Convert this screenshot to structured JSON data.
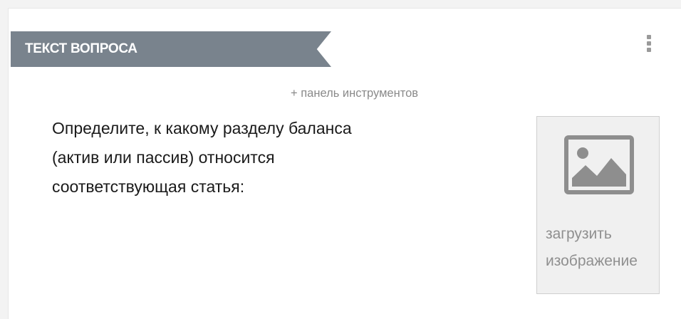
{
  "section": {
    "title": "ТЕКСТ ВОПРОСА"
  },
  "menu": {
    "icon": "kebab-menu-icon"
  },
  "toolbar": {
    "toggle_label": "+ панель инструментов"
  },
  "question": {
    "text_lines": [
      "Определите, к какому разделу баланса",
      "(актив или пассив) относится",
      "соответствующая статья:"
    ]
  },
  "image_upload": {
    "icon": "image-icon",
    "label": "загрузить изображение"
  },
  "colors": {
    "tab_background": "#79838d",
    "text_primary": "#1a1a1a",
    "text_muted": "#8a8a8a",
    "upload_background": "#f0f0f0"
  }
}
